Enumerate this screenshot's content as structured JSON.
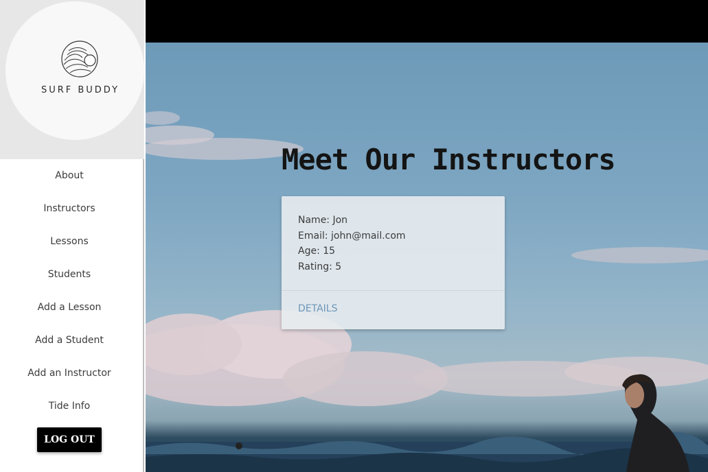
{
  "brand": {
    "name": "SURF BUDDY",
    "logo_icon": "wave-sun-icon"
  },
  "sidebar": {
    "items": [
      {
        "label": "About"
      },
      {
        "label": "Instructors"
      },
      {
        "label": "Lessons"
      },
      {
        "label": "Students"
      },
      {
        "label": "Add a Lesson"
      },
      {
        "label": "Add a Student"
      },
      {
        "label": "Add an Instructor"
      },
      {
        "label": "Tide Info"
      }
    ],
    "logout_label": "LOG OUT"
  },
  "main": {
    "title": "Meet Our Instructors",
    "instructors": [
      {
        "name": "Name: Jon",
        "email": "Email: john@mail.com",
        "age": "Age: 15",
        "rating": "Rating: 5",
        "action_label": "DETAILS"
      }
    ]
  },
  "colors": {
    "topbar": "#000000",
    "logout_button": "#000000",
    "link_accent": "#6b95b8",
    "card_background": "#e8ecf0"
  }
}
